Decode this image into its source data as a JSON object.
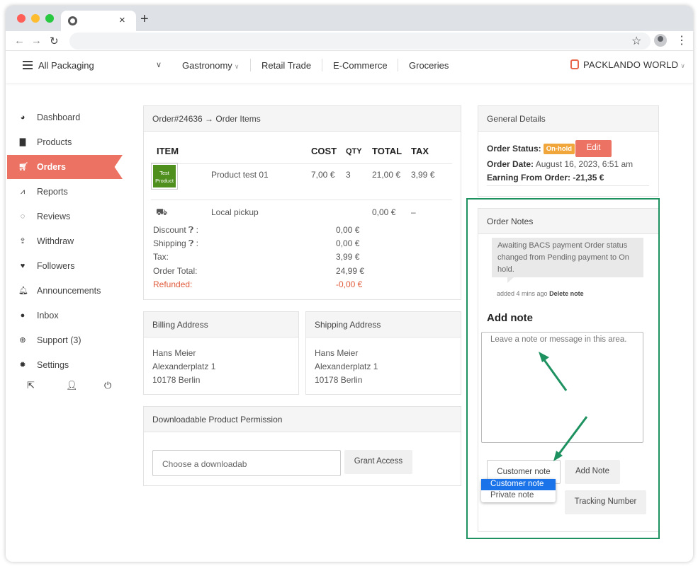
{
  "browser": {
    "new_tab": "+",
    "close": "×"
  },
  "header": {
    "menu_label": "All Packaging",
    "nav": [
      "Gastronomy",
      "Retail Trade",
      "E-Commerce",
      "Groceries"
    ],
    "brand": "PACKLANDO WORLD"
  },
  "sidebar": {
    "items": [
      {
        "label": "Dashboard",
        "icon": "dashboard-icon"
      },
      {
        "label": "Products",
        "icon": "briefcase-icon"
      },
      {
        "label": "Orders",
        "icon": "cart-icon"
      },
      {
        "label": "Reports",
        "icon": "chart-icon"
      },
      {
        "label": "Reviews",
        "icon": "comments-icon"
      },
      {
        "label": "Withdraw",
        "icon": "upload-icon"
      },
      {
        "label": "Followers",
        "icon": "heart-icon"
      },
      {
        "label": "Announcements",
        "icon": "bell-icon"
      },
      {
        "label": "Inbox",
        "icon": "chat-icon"
      },
      {
        "label": "Support (3)",
        "icon": "lifebuoy-icon"
      },
      {
        "label": "Settings",
        "icon": "gear-icon"
      }
    ]
  },
  "order_items": {
    "title": "Order#24636 → Order Items",
    "headers": {
      "item": "ITEM",
      "cost": "COST",
      "qty": "QTY",
      "total": "TOTAL",
      "tax": "TAX"
    },
    "thumb": "Test Product",
    "row": {
      "name": "Product test 01",
      "cost": "7,00 €",
      "qty": "3",
      "total": "21,00 €",
      "tax": "3,99 €"
    },
    "shipping": {
      "name": "Local pickup",
      "total": "0,00 €",
      "tax": "–"
    },
    "summary": [
      {
        "label": "Discount",
        "value": "0,00 €"
      },
      {
        "label": "Shipping",
        "value": "0,00 €"
      },
      {
        "label": "Tax:",
        "value": "3,99 €"
      },
      {
        "label": "Order Total:",
        "value": "24,99 €"
      },
      {
        "label": "Refunded:",
        "value": "-0,00 €"
      }
    ]
  },
  "billing": {
    "title": "Billing Address",
    "lines": [
      "Hans Meier",
      "Alexanderplatz 1",
      "10178 Berlin"
    ]
  },
  "shipping_address": {
    "title": "Shipping Address",
    "lines": [
      "Hans Meier",
      "Alexanderplatz 1",
      "10178 Berlin"
    ]
  },
  "download": {
    "title": "Downloadable Product Permission",
    "placeholder": "Choose a downloadab",
    "grant": "Grant Access"
  },
  "general": {
    "title": "General Details",
    "status_label": "Order Status:",
    "status": "On-hold",
    "edit": "Edit",
    "date_label": "Order Date:",
    "date": "August 16, 2023, 6:51 am",
    "earning_label": "Earning From Order:",
    "earning": "-21,35 €"
  },
  "notes": {
    "title": "Order Notes",
    "note_text": "Awaiting BACS payment Order status changed from Pending payment to On hold.",
    "meta": "added 4 mins ago",
    "delete": "Delete note",
    "add_heading": "Add note",
    "placeholder": "Leave a note or message in this area.",
    "select_value": "Customer note",
    "add_button": "Add Note",
    "options": [
      "Customer note",
      "Private note"
    ],
    "tracking": "Tracking Number"
  },
  "colors": {
    "accent": "#ec7363",
    "highlight": "#1e9160",
    "badge": "#f0a63a"
  }
}
